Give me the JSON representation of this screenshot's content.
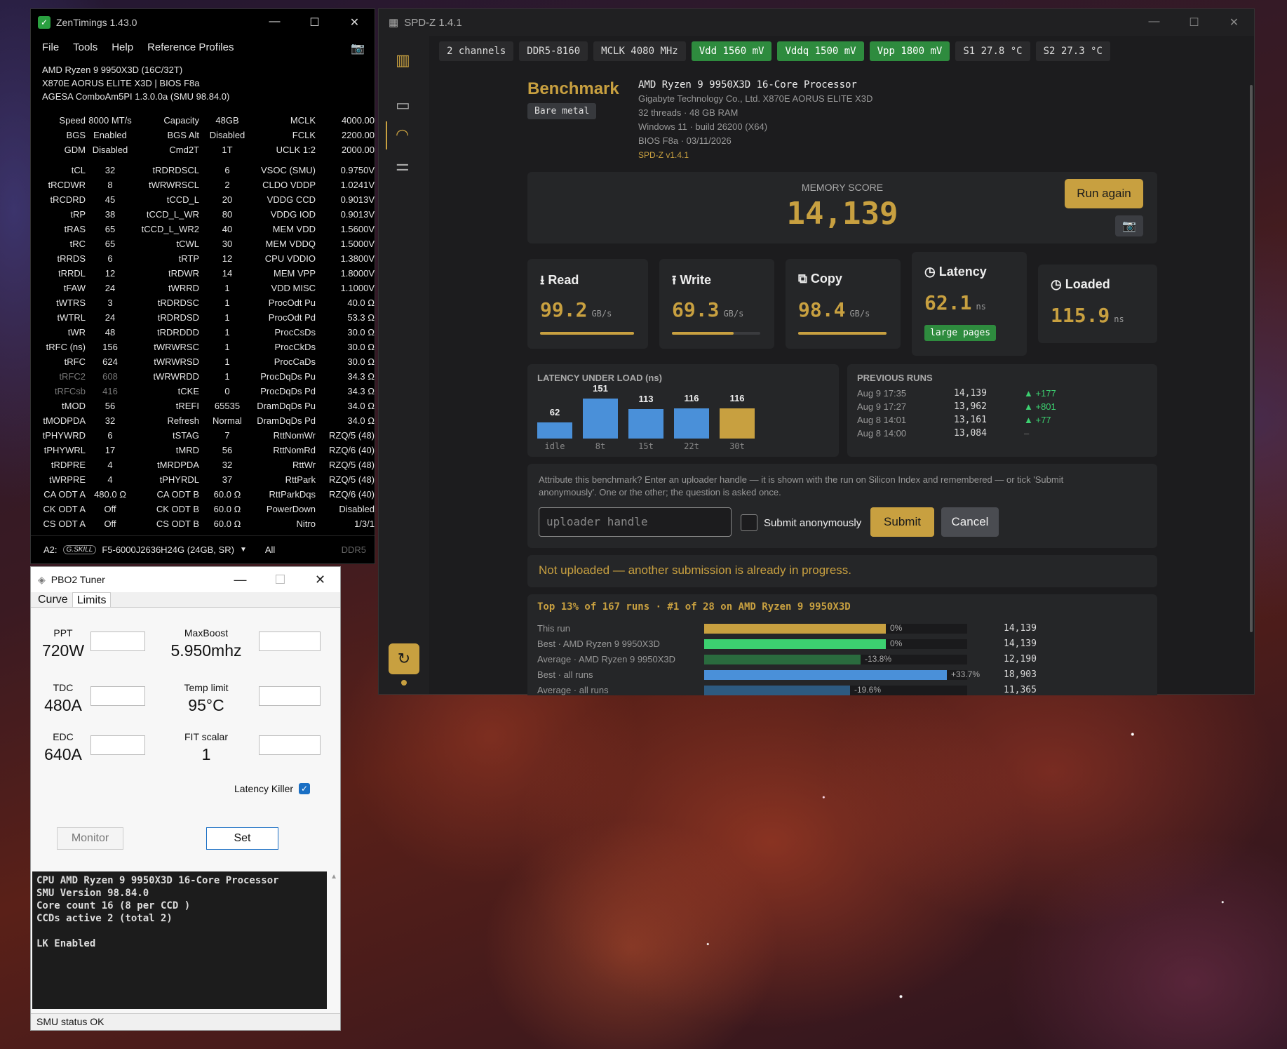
{
  "zen": {
    "title": "ZenTimings 1.43.0",
    "menu": [
      "File",
      "Tools",
      "Help",
      "Reference Profiles"
    ],
    "sys": [
      "AMD Ryzen 9 9950X3D (16C/32T)",
      "X870E AORUS ELITE X3D | BIOS F8a",
      "AGESA ComboAm5PI 1.3.0.0a (SMU 98.84.0)"
    ],
    "top": [
      [
        "Speed",
        "8000 MT/s",
        "Capacity",
        "48GB",
        "MCLK",
        "4000.00"
      ],
      [
        "BGS",
        "Enabled",
        "BGS Alt",
        "Disabled",
        "FCLK",
        "2200.00"
      ],
      [
        "GDM",
        "Disabled",
        "Cmd2T",
        "1T",
        "UCLK  1:2",
        "2000.00"
      ]
    ],
    "rows": [
      [
        "tCL",
        "32",
        "tRDRDSCL",
        "6",
        "VSOC (SMU)",
        "0.9750V"
      ],
      [
        "tRCDWR",
        "8",
        "tWRWRSCL",
        "2",
        "CLDO VDDP",
        "1.0241V"
      ],
      [
        "tRCDRD",
        "45",
        "tCCD_L",
        "20",
        "VDDG CCD",
        "0.9013V"
      ],
      [
        "tRP",
        "38",
        "tCCD_L_WR",
        "80",
        "VDDG IOD",
        "0.9013V"
      ],
      [
        "tRAS",
        "65",
        "tCCD_L_WR2",
        "40",
        "MEM VDD",
        "1.5600V"
      ],
      [
        "tRC",
        "65",
        "tCWL",
        "30",
        "MEM VDDQ",
        "1.5000V"
      ],
      [
        "tRRDS",
        "6",
        "tRTP",
        "12",
        "CPU VDDIO",
        "1.3800V"
      ],
      [
        "tRRDL",
        "12",
        "tRDWR",
        "14",
        "MEM VPP",
        "1.8000V"
      ],
      [
        "tFAW",
        "24",
        "tWRRD",
        "1",
        "VDD MISC",
        "1.1000V"
      ],
      [
        "tWTRS",
        "3",
        "tRDRDSC",
        "1",
        "ProcOdt Pu",
        "40.0 Ω"
      ],
      [
        "tWTRL",
        "24",
        "tRDRDSD",
        "1",
        "ProcOdt Pd",
        "53.3 Ω"
      ],
      [
        "tWR",
        "48",
        "tRDRDDD",
        "1",
        "ProcCsDs",
        "30.0 Ω"
      ],
      [
        "tRFC (ns)",
        "156",
        "tWRWRSC",
        "1",
        "ProcCkDs",
        "30.0 Ω"
      ],
      [
        "tRFC",
        "624",
        "tWRWRSD",
        "1",
        "ProcCaDs",
        "30.0 Ω"
      ],
      [
        "tRFC2",
        "608",
        "tWRWRDD",
        "1",
        "ProcDqDs Pu",
        "34.3 Ω"
      ],
      [
        "tRFCsb",
        "416",
        "tCKE",
        "0",
        "ProcDqDs Pd",
        "34.3 Ω"
      ],
      [
        "tMOD",
        "56",
        "tREFI",
        "65535",
        "DramDqDs Pu",
        "34.0 Ω"
      ],
      [
        "tMODPDA",
        "32",
        "Refresh",
        "Normal",
        "DramDqDs Pd",
        "34.0 Ω"
      ],
      [
        "tPHYWRD",
        "6",
        "tSTAG",
        "7",
        "RttNomWr",
        "RZQ/5 (48)"
      ],
      [
        "tPHYWRL",
        "17",
        "tMRD",
        "56",
        "RttNomRd",
        "RZQ/6 (40)"
      ],
      [
        "tRDPRE",
        "4",
        "tMRDPDA",
        "32",
        "RttWr",
        "RZQ/5 (48)"
      ],
      [
        "tWRPRE",
        "4",
        "tPHYRDL",
        "37",
        "RttPark",
        "RZQ/5 (48)"
      ],
      [
        "CA ODT A",
        "480.0 Ω",
        "CA ODT B",
        "60.0 Ω",
        "RttParkDqs",
        "RZQ/6 (40)"
      ],
      [
        "CK ODT A",
        "Off",
        "CK ODT B",
        "60.0 Ω",
        "PowerDown",
        "Disabled"
      ],
      [
        "CS ODT A",
        "Off",
        "CS ODT B",
        "60.0 Ω",
        "Nitro",
        "1/3/1"
      ]
    ],
    "foot_slot": "A2:",
    "foot_brand": "G.SKILL",
    "foot_module": "F5-6000J2636H24G (24GB, SR)",
    "foot_all": "All",
    "foot_ddr": "DDR5"
  },
  "pbo": {
    "title": "PBO2 Tuner",
    "tabs": [
      "Curve",
      "Limits"
    ],
    "fields": [
      {
        "label": "PPT",
        "value": "720W"
      },
      {
        "label": "TDC",
        "value": "480A"
      },
      {
        "label": "EDC",
        "value": "640A"
      },
      {
        "label": "MaxBoost",
        "value": "5.950mhz"
      },
      {
        "label": "Temp limit",
        "value": "95°C"
      },
      {
        "label": "FIT scalar",
        "value": "1"
      }
    ],
    "lk_label": "Latency Killer",
    "monitor": "Monitor",
    "set": "Set",
    "console": "CPU AMD Ryzen 9 9950X3D 16-Core Processor\nSMU Version 98.84.0\nCore count 16 (8 per CCD )\nCCDs active 2 (total 2)\n\nLK Enabled",
    "status": "SMU status OK"
  },
  "spd": {
    "title": "SPD-Z 1.4.1",
    "chips": [
      "2 channels",
      "DDR5-8160",
      "MCLK 4080 MHz",
      "Vdd 1560 mV",
      "Vddq 1500 mV",
      "Vpp 1800 mV",
      "S1 27.8 °C",
      "S2 27.3 °C"
    ],
    "bench": "Benchmark",
    "bare": "Bare metal",
    "info": {
      "cpu": "AMD Ryzen 9 9950X3D 16-Core Processor",
      "board": "Gigabyte Technology Co., Ltd. X870E AORUS ELITE X3D",
      "ram": "32 threads · 48 GB RAM",
      "os": "Windows 11 · build 26200 (X64)",
      "bios": "BIOS F8a · 03/11/2026",
      "ver": "SPD-Z v1.4.1"
    },
    "score_label": "MEMORY SCORE",
    "score": "14,139",
    "run_again": "Run again",
    "read": {
      "label": "Read",
      "value": "99.2",
      "unit": "GB/s",
      "fill": 1.0
    },
    "write": {
      "label": "Write",
      "value": "69.3",
      "unit": "GB/s",
      "fill": 0.7
    },
    "copy": {
      "label": "Copy",
      "value": "98.4",
      "unit": "GB/s",
      "fill": 1.0
    },
    "latency": {
      "label": "Latency",
      "value": "62.1",
      "unit": "ns",
      "badge": "large pages"
    },
    "loaded": {
      "label": "Loaded",
      "value": "115.9",
      "unit": "ns"
    },
    "lul_title": "LATENCY UNDER LOAD (ns)",
    "lul": [
      {
        "v": "62",
        "c": "idle",
        "n": 62
      },
      {
        "v": "151",
        "c": "8t",
        "n": 151
      },
      {
        "v": "113",
        "c": "15t",
        "n": 113
      },
      {
        "v": "116",
        "c": "22t",
        "n": 116
      },
      {
        "v": "116",
        "c": "30t",
        "n": 116
      }
    ],
    "prev_title": "PREVIOUS RUNS",
    "prev": [
      {
        "d": "Aug 9 17:35",
        "s": "14,139",
        "delta": "▲ +177"
      },
      {
        "d": "Aug 9 17:27",
        "s": "13,962",
        "delta": "▲ +801"
      },
      {
        "d": "Aug 8 14:01",
        "s": "13,161",
        "delta": "▲ +77"
      },
      {
        "d": "Aug 8 14:00",
        "s": "13,084",
        "delta": "–"
      }
    ],
    "attr": "Attribute this benchmark? Enter an uploader handle — it is shown with the run on Silicon Index and remembered — or tick 'Submit anonymously'. One or the other; the question is asked once.",
    "placeholder": "uploader handle",
    "anon": "Submit anonymously",
    "submit": "Submit",
    "cancel": "Cancel",
    "warn": "Not uploaded — another submission is already in progress.",
    "rank": "Top 13% of 167 runs · #1 of 28 on AMD Ryzen 9 9950X3D",
    "compare": [
      {
        "label": "This run",
        "pct": "0%",
        "value": "14,139",
        "n": 14139,
        "color": "#c8a040"
      },
      {
        "label": "Best · AMD Ryzen 9 9950X3D",
        "pct": "0%",
        "value": "14,139",
        "n": 14139,
        "color": "#3cd070"
      },
      {
        "label": "Average · AMD Ryzen 9 9950X3D",
        "pct": "-13.8%",
        "value": "12,190",
        "n": 12190,
        "color": "#2a6b3e"
      },
      {
        "label": "Best · all runs",
        "pct": "+33.7%",
        "value": "18,903",
        "n": 18903,
        "color": "#4a90d9"
      },
      {
        "label": "Average · all runs",
        "pct": "-19.6%",
        "value": "11,365",
        "n": 11365,
        "color": "#2d5a80"
      }
    ]
  }
}
